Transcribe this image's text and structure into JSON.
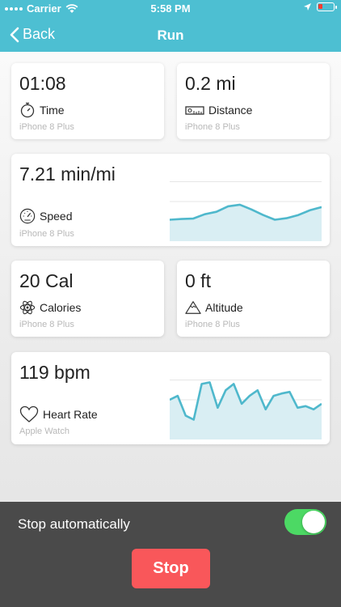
{
  "status_bar": {
    "carrier": "Carrier",
    "time": "5:58 PM"
  },
  "nav": {
    "back_label": "Back",
    "title": "Run"
  },
  "colors": {
    "header": "#4dbfd2",
    "chart_line": "#4fb8cc",
    "chart_fill": "#d9eef3",
    "stop": "#f9575a",
    "toggle_on": "#4cd964"
  },
  "cards": {
    "time": {
      "value": "01:08",
      "label": "Time",
      "source": "iPhone 8 Plus",
      "icon": "stopwatch-icon"
    },
    "distance": {
      "value": "0.2 mi",
      "label": "Distance",
      "source": "iPhone 8 Plus",
      "icon": "ruler-icon"
    },
    "speed": {
      "value": "7.21 min/mi",
      "label": "Speed",
      "source": "iPhone 8 Plus",
      "icon": "speedometer-icon"
    },
    "calories": {
      "value": "20 Cal",
      "label": "Calories",
      "source": "iPhone 8 Plus",
      "icon": "atom-icon"
    },
    "altitude": {
      "value": "0 ft",
      "label": "Altitude",
      "source": "iPhone 8 Plus",
      "icon": "mountain-icon"
    },
    "heart_rate": {
      "value": "119 bpm",
      "label": "Heart Rate",
      "source": "Apple Watch",
      "icon": "heart-icon"
    }
  },
  "chart_data": [
    {
      "type": "area",
      "x": [
        0,
        1,
        2,
        3,
        4,
        5,
        6,
        7,
        8,
        9,
        10,
        11,
        12,
        13
      ],
      "values": [
        27,
        28,
        28.5,
        34,
        37,
        44,
        46,
        40,
        33,
        27,
        29,
        33,
        39,
        43
      ],
      "ylim": [
        0,
        100
      ],
      "grid": true
    },
    {
      "type": "area",
      "x": [
        0,
        1,
        2,
        3,
        4,
        5,
        6,
        7,
        8,
        9,
        10,
        11,
        12,
        13,
        14,
        15,
        16,
        17,
        18,
        19
      ],
      "values": [
        50,
        55,
        30,
        25,
        70,
        72,
        40,
        62,
        70,
        45,
        55,
        62,
        38,
        55,
        58,
        60,
        40,
        42,
        38,
        45
      ],
      "ylim": [
        0,
        100
      ],
      "grid": true
    }
  ],
  "bottom": {
    "stop_auto_label": "Stop automatically",
    "stop_auto_on": true,
    "stop_label": "Stop"
  }
}
